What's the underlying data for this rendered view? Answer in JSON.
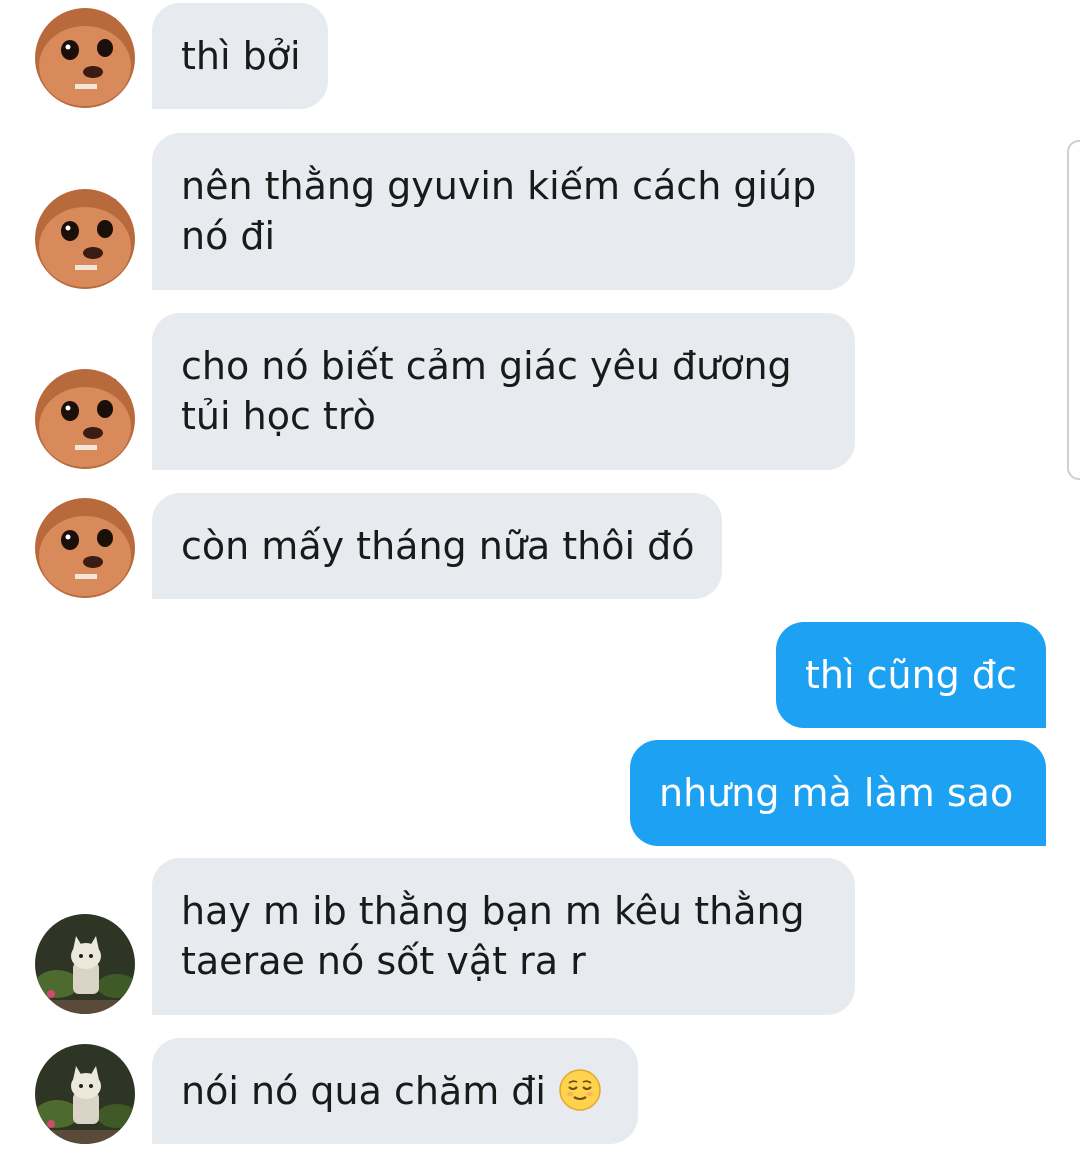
{
  "conversation": {
    "messages": [
      {
        "sender": "other",
        "avatar": "chihuahua-avatar",
        "lines": [
          "thì bởi"
        ]
      },
      {
        "sender": "other",
        "avatar": "chihuahua-avatar",
        "lines": [
          "nên thằng gyuvin kiếm cách giúp",
          "nó đi"
        ]
      },
      {
        "sender": "other",
        "avatar": "chihuahua-avatar",
        "lines": [
          "cho nó biết cảm giác yêu đương",
          "tủi học trò"
        ]
      },
      {
        "sender": "other",
        "avatar": "chihuahua-avatar",
        "lines": [
          "còn mấy tháng nữa thôi đó"
        ]
      },
      {
        "sender": "me",
        "lines": [
          "thì cũng đc"
        ]
      },
      {
        "sender": "me",
        "lines": [
          "nhưng mà làm sao"
        ]
      },
      {
        "sender": "other",
        "avatar": "cat-plant-avatar",
        "lines": [
          "hay m ib thằng bạn m kêu thằng",
          "taerae nó sốt vật ra r"
        ]
      },
      {
        "sender": "other",
        "avatar": "cat-plant-avatar",
        "lines": [
          "nói nó qua chăm đi"
        ],
        "emoji": "relieved-face-emoji"
      }
    ]
  },
  "colors": {
    "incoming_bubble": "#e7ebef",
    "outgoing_bubble": "#1da1f2",
    "incoming_text": "#1a1a1a",
    "outgoing_text": "#ffffff"
  }
}
